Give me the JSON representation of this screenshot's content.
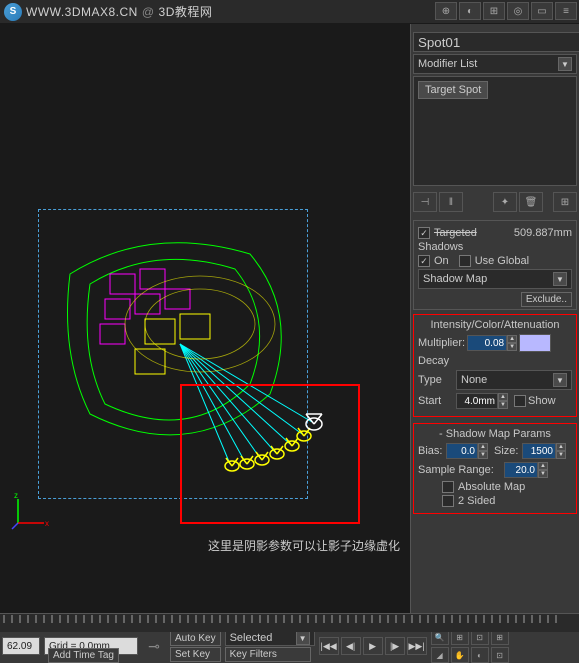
{
  "header": {
    "site": "WWW.3DMAX8.CN",
    "at": "@",
    "tag": "3D教程网"
  },
  "object": {
    "name": "Spot01"
  },
  "modifier": {
    "dropdown_label": "Modifier List",
    "stack_item": "Target Spot"
  },
  "general": {
    "target_label": "Targeted",
    "target_value": "509.887mm",
    "shadows_title": "Shadows",
    "on_label": "On",
    "use_global_label": "Use Global",
    "shadow_type": "Shadow Map",
    "exclude_btn": "Exclude.."
  },
  "intensity": {
    "title": "Intensity/Color/Attenuation",
    "multiplier_label": "Multiplier:",
    "multiplier_value": "0.08",
    "decay_label": "Decay",
    "type_label": "Type",
    "type_value": "None",
    "start_label": "Start",
    "start_value": "4.0mm",
    "show_label": "Show"
  },
  "shadowmap": {
    "title": "- Shadow Map Params",
    "bias_label": "Bias:",
    "bias_value": "0.0",
    "size_label": "Size:",
    "size_value": "1500",
    "sample_label": "Sample Range:",
    "sample_value": "20.0",
    "absolute_label": "Absolute Map",
    "two_sided_label": "2 Sided"
  },
  "viewport": {
    "caption": "这里是阴影参数可以让影子边缘虚化"
  },
  "status": {
    "frame": "62.09",
    "grid": "Grid = 0.0mm",
    "auto_key": "Auto Key",
    "selected": "Selected",
    "set_key": "Set Key",
    "key_filters": "Key Filters",
    "add_time_tag": "Add Time Tag"
  }
}
